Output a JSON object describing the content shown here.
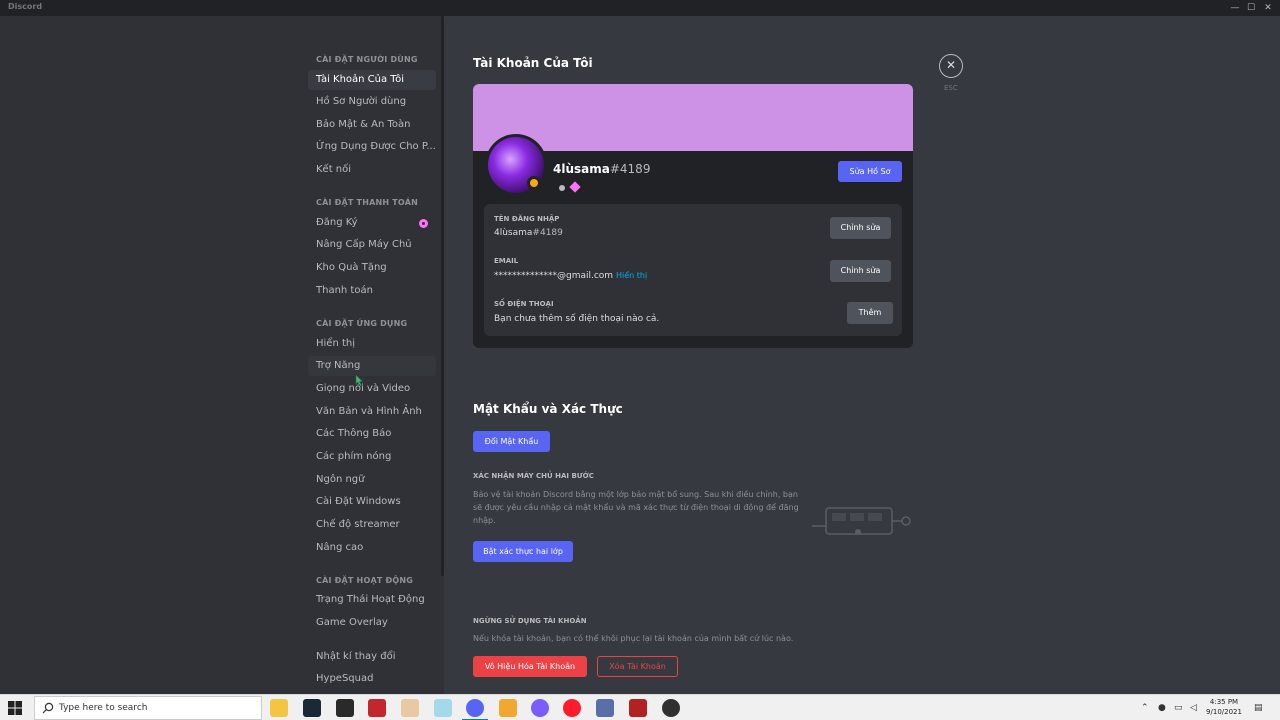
{
  "window": {
    "title": "Discord",
    "controls": [
      "—",
      "☐",
      "✕"
    ]
  },
  "sidebar": {
    "sections": [
      {
        "header": "CÀI ĐẶT NGƯỜI DÙNG",
        "items": [
          "Tài Khoản Của Tôi",
          "Hồ Sơ Người dùng",
          "Bảo Mật & An Toàn",
          "Ứng Dụng Được Cho P...",
          "Kết nối"
        ]
      },
      {
        "header": "CÀI ĐẶT THANH TOÁN",
        "items": [
          "Đăng Ký",
          "Nâng Cấp Máy Chủ",
          "Kho Quà Tặng",
          "Thanh toán"
        ]
      },
      {
        "header": "CÀI ĐẶT ỨNG DỤNG",
        "items": [
          "Hiển thị",
          "Trợ Năng",
          "Giọng nói và Video",
          "Văn Bản và Hình Ảnh",
          "Các Thông Báo",
          "Các phím nóng",
          "Ngôn ngữ",
          "Cài Đặt Windows",
          "Chế độ streamer",
          "Nâng cao"
        ]
      },
      {
        "header": "CÀI ĐẶT HOẠT ĐỘNG",
        "items": [
          "Trạng Thái Hoạt Động",
          "Game Overlay"
        ]
      },
      {
        "header": "",
        "items": [
          "Nhật kí thay đổi",
          "HypeSquad"
        ]
      }
    ],
    "active_item": "Tài Khoản Của Tôi",
    "hovered_item": "Trợ Năng"
  },
  "main": {
    "title": "Tài Khoản Của Tôi",
    "close_label": "ESC",
    "profile": {
      "banner_color": "#cd92e5",
      "username": "4lùsama",
      "discriminator": "#4189",
      "edit_button": "Sửa Hồ Sơ",
      "fields": [
        {
          "label": "TÊN ĐĂNG NHẬP",
          "value": "4lùsama",
          "value_suffix": "#4189",
          "button": "Chỉnh sửa"
        },
        {
          "label": "EMAIL",
          "value": "**************@gmail.com",
          "link": "Hiển thị",
          "button": "Chỉnh sửa"
        },
        {
          "label": "SỐ ĐIỆN THOẠI",
          "value": "Bạn chưa thêm số điện thoại nào cả.",
          "button": "Thêm"
        }
      ]
    },
    "password_section": {
      "title": "Mật Khẩu và Xác Thực",
      "change_password_button": "Đổi Mật Khẩu",
      "mfa_header": "XÁC NHẬN MÁY CHỦ HAI BƯỚC",
      "mfa_text_lines": [
        "Bảo vệ tài khoản Discord bằng một lớp bảo mật bổ sung. Sau khi điều chỉnh, bạn",
        "sẽ được yêu cầu nhập cả mật khẩu và mã xác thực từ điện thoại di động để đăng",
        "nhập."
      ],
      "mfa_button": "Bật xác thực hai lớp"
    },
    "disable_section": {
      "header": "NGỪNG SỬ DỤNG TÀI KHOẢN",
      "text": "Nếu khóa tài khoản, bạn có thể khôi phục lại tài khoản của mình bất cứ lúc nào.",
      "disable_button": "Vô Hiệu Hóa Tài Khoản",
      "delete_button": "Xóa Tài Khoản"
    }
  },
  "taskbar": {
    "search_placeholder": "Type here to search",
    "apps": [
      "file-explorer",
      "steam",
      "epic-games",
      "app-red",
      "app-cartoon",
      "app-pinwheel",
      "discord",
      "app-folder",
      "messenger",
      "opera",
      "app-doc",
      "app-video",
      "obs"
    ],
    "time": "4:35 PM",
    "date": "9/10/2021"
  },
  "colors": {
    "accent": "#5865f2",
    "danger": "#ed4245",
    "link": "#00aff4",
    "nitro": "#ff73fa"
  }
}
